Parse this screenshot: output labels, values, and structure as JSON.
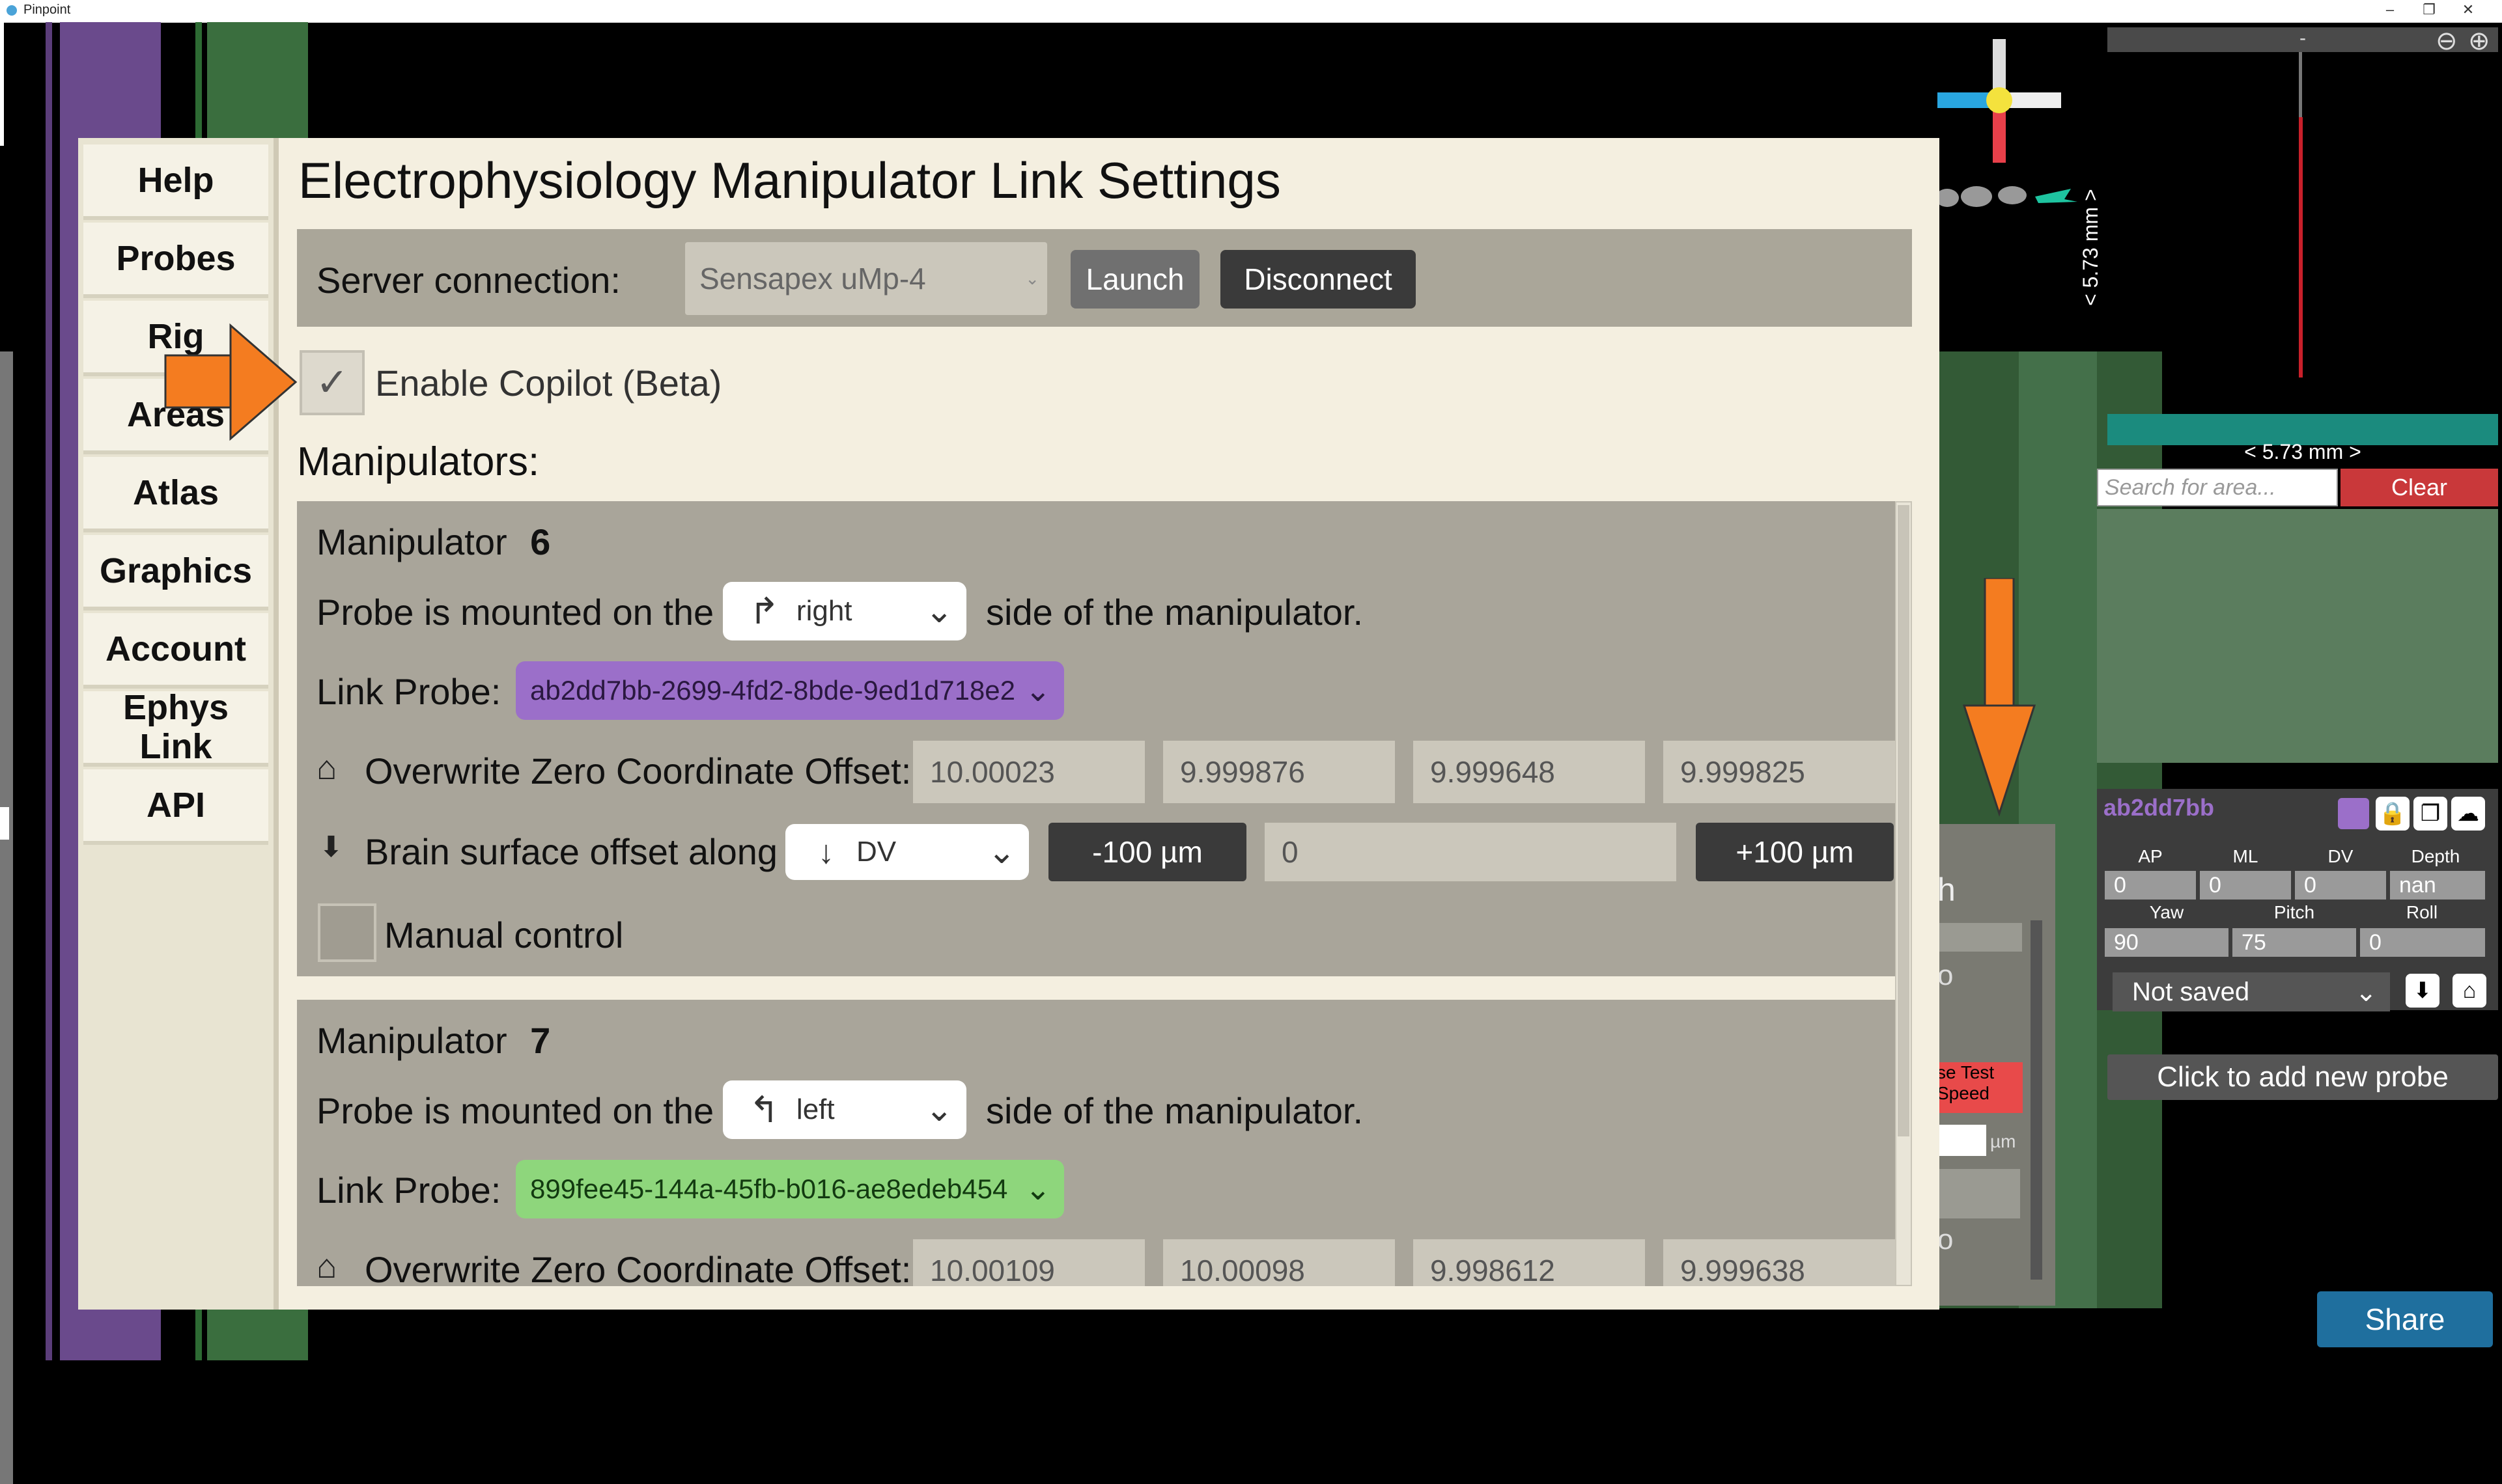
{
  "window": {
    "title": "Pinpoint",
    "controls": [
      "–",
      "❐",
      "✕"
    ]
  },
  "menu": {
    "items": [
      "Help",
      "Probes",
      "Rig",
      "Areas",
      "Atlas",
      "Graphics",
      "Account",
      "Ephys\nLink",
      "API"
    ]
  },
  "panel": {
    "title": "Electrophysiology Manipulator Link Settings",
    "server_label": "Server connection:",
    "server_value": "Sensapex uMp-4",
    "launch": "Launch",
    "disconnect": "Disconnect",
    "copilot_label": "Enable Copilot (Beta)",
    "manipulators_label": "Manipulators:"
  },
  "manipulators": [
    {
      "title": "Manipulator",
      "id": "6",
      "mount_prefix": "Probe is mounted on the",
      "mount_side": "right",
      "mount_suffix": "side of the manipulator.",
      "link_label": "Link Probe:",
      "probe": "ab2dd7bb-2699-4fd2-8bde-9ed1d718e2",
      "probe_color": "#9b6fc9",
      "zero_label": "Overwrite Zero Coordinate Offset:",
      "zero": [
        "10.00023",
        "9.999876",
        "9.999648",
        "9.999825"
      ],
      "brain_label": "Brain surface offset along",
      "axis": "DV",
      "minus": "-100 µm",
      "offset": "0",
      "plus": "+100 µm",
      "manual": "Manual control"
    },
    {
      "title": "Manipulator",
      "id": "7",
      "mount_prefix": "Probe is mounted on the",
      "mount_side": "left",
      "mount_suffix": "side of the manipulator.",
      "link_label": "Link Probe:",
      "probe": "899fee45-144a-45fb-b016-ae8edeb454",
      "probe_color": "#8ed67c",
      "zero_label": "Overwrite Zero Coordinate Offset:",
      "zero": [
        "10.00109",
        "10.00098",
        "9.998612",
        "9.999638"
      ]
    }
  ],
  "right_panel": {
    "top_dash": "-",
    "scale_vertical": "< 5.73 mm >",
    "scale_horizontal": "< 5.73 mm >",
    "search_placeholder": "Search for area...",
    "clear": "Clear",
    "probe_name": "ab2dd7bb",
    "labels_row1": [
      "AP",
      "ML",
      "DV",
      "Depth"
    ],
    "values_row1": [
      "0",
      "0",
      "0",
      "nan"
    ],
    "labels_row2": [
      "Yaw",
      "Pitch",
      "Roll"
    ],
    "values_row2": [
      "90",
      "75",
      "0"
    ],
    "saved_state": "Not saved",
    "add_probe": "Click to add new probe",
    "share": "Share"
  },
  "hidden_panel": {
    "h": "h",
    "o1": "o",
    "test_speed": "se Test\nSpeed",
    "um": "µm",
    "o2": "o"
  },
  "colors": {
    "panel_bg": "#f4efe0",
    "manip_bg": "#a9a59a",
    "arrow": "#f47c20",
    "clear_btn": "#c9383a",
    "share_btn": "#1f6f9e"
  }
}
